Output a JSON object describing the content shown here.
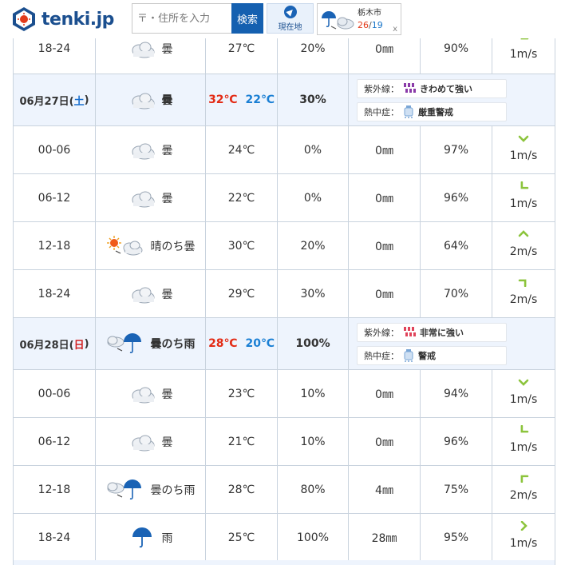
{
  "header": {
    "logo_text": "tenki.jp",
    "search_placeholder": "〒・住所を入力",
    "search_button": "検索",
    "location_button": "現在地",
    "city": {
      "name": "栃木市",
      "high": "26",
      "separator": "/",
      "low": "19",
      "close": "x"
    }
  },
  "colors": {
    "brand": "#1b4f8f",
    "accent": "#1560b0",
    "high_temp": "#e32b15",
    "low_temp": "#1a7fd4",
    "day_row": "#eef4fd",
    "wind_arrow": "#8cc43c"
  },
  "rows": [
    {
      "type": "hour",
      "time": "18-24",
      "icon": "cloud-icon",
      "weather": "曇",
      "temp": "27℃",
      "prob": "20%",
      "rain": "0㎜",
      "humidity": "90%",
      "wind_dir": "sw",
      "wind": "1m/s"
    },
    {
      "type": "day",
      "date": "06月27日(",
      "dow": "土",
      "close": ")",
      "icon": "cloud-icon",
      "weather": "曇",
      "high": "32℃",
      "low": "22℃",
      "prob": "30%",
      "uv_label": "紫外線：",
      "uv_value": "きわめて強い",
      "heat_label": "熱中症：",
      "heat_value": "厳重警戒"
    },
    {
      "type": "hour",
      "time": "00-06",
      "icon": "cloud-icon",
      "weather": "曇",
      "temp": "24℃",
      "prob": "0%",
      "rain": "0㎜",
      "humidity": "97%",
      "wind_dir": "s",
      "wind": "1m/s"
    },
    {
      "type": "hour",
      "time": "06-12",
      "icon": "cloud-icon",
      "weather": "曇",
      "temp": "22℃",
      "prob": "0%",
      "rain": "0㎜",
      "humidity": "96%",
      "wind_dir": "sw",
      "wind": "1m/s"
    },
    {
      "type": "hour",
      "time": "12-18",
      "icon": "sun-then-cloud-icon",
      "weather": "晴のち曇",
      "temp": "30℃",
      "prob": "20%",
      "rain": "0㎜",
      "humidity": "64%",
      "wind_dir": "n",
      "wind": "2m/s"
    },
    {
      "type": "hour",
      "time": "18-24",
      "icon": "cloud-icon",
      "weather": "曇",
      "temp": "29℃",
      "prob": "30%",
      "rain": "0㎜",
      "humidity": "70%",
      "wind_dir": "ne",
      "wind": "2m/s"
    },
    {
      "type": "day",
      "date": "06月28日(",
      "dow": "日",
      "close": ")",
      "icon": "cloud-then-rain-icon",
      "weather": "曇のち雨",
      "high": "28℃",
      "low": "20℃",
      "prob": "100%",
      "uv_label": "紫外線：",
      "uv_value": "非常に強い",
      "heat_label": "熱中症：",
      "heat_value": "警戒"
    },
    {
      "type": "hour",
      "time": "00-06",
      "icon": "cloud-icon",
      "weather": "曇",
      "temp": "23℃",
      "prob": "10%",
      "rain": "0㎜",
      "humidity": "94%",
      "wind_dir": "s",
      "wind": "1m/s"
    },
    {
      "type": "hour",
      "time": "06-12",
      "icon": "cloud-icon",
      "weather": "曇",
      "temp": "21℃",
      "prob": "10%",
      "rain": "0㎜",
      "humidity": "96%",
      "wind_dir": "sw",
      "wind": "1m/s"
    },
    {
      "type": "hour",
      "time": "12-18",
      "icon": "cloud-then-rain-icon",
      "weather": "曇のち雨",
      "temp": "28℃",
      "prob": "80%",
      "rain": "4㎜",
      "humidity": "75%",
      "wind_dir": "nw",
      "wind": "2m/s"
    },
    {
      "type": "hour",
      "time": "18-24",
      "icon": "rain-icon",
      "weather": "雨",
      "temp": "25℃",
      "prob": "100%",
      "rain": "28㎜",
      "humidity": "95%",
      "wind_dir": "e",
      "wind": "1m/s"
    }
  ]
}
